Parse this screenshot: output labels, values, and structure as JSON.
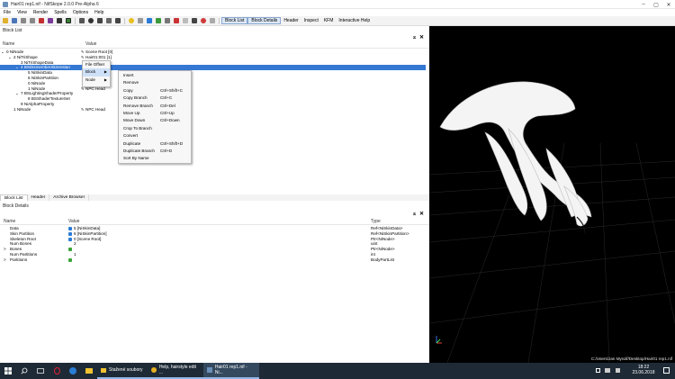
{
  "window": {
    "title": "Hair01 rep1.nif - NifSkope 2.0.0 Pre-Alpha 6"
  },
  "menubar": [
    "File",
    "View",
    "Render",
    "Spells",
    "Options",
    "Help"
  ],
  "toolbar": {
    "buttons": [
      "Block List",
      "Block Details",
      "Header",
      "Inspect",
      "KFM",
      "Interactive Help"
    ]
  },
  "block_list": {
    "title": "Block List",
    "col_name": "Name",
    "col_value": "Value",
    "rows": [
      {
        "name": "0 NiNode",
        "value": "Scene Root [0]",
        "indent": 0,
        "expand": "⌄"
      },
      {
        "name": "2 NiTriShape",
        "value": "Hair01:001 [1]",
        "indent": 1,
        "expand": "⌄"
      },
      {
        "name": "3 NiTriShapeData",
        "value": "",
        "indent": 2,
        "expand": ""
      },
      {
        "name": "4 BSDismemberSkinInstan",
        "value": "",
        "indent": 2,
        "expand": "⌄",
        "selected": true
      },
      {
        "name": "5 NiSkinData",
        "value": "",
        "indent": 3,
        "expand": ""
      },
      {
        "name": "6 NiSkinPartition",
        "value": "",
        "indent": 3,
        "expand": ""
      },
      {
        "name": "0 NiNode",
        "value": "",
        "indent": 3,
        "expand": ""
      },
      {
        "name": "1 NiNode",
        "value": "NPC Head",
        "indent": 3,
        "expand": ""
      },
      {
        "name": "7 BSLightingShaderProperty",
        "value": "",
        "indent": 2,
        "expand": "⌄"
      },
      {
        "name": "8 BSShaderTextureSet",
        "value": "",
        "indent": 3,
        "expand": ""
      },
      {
        "name": "9 NiAlphaProperty",
        "value": "",
        "indent": 2,
        "expand": ""
      },
      {
        "name": "1 NiNode",
        "value": "NPC Head",
        "indent": 1,
        "expand": ""
      }
    ]
  },
  "context_menu": {
    "items": [
      "File Offset",
      "Block",
      "Node"
    ]
  },
  "block_submenu": {
    "items": [
      {
        "label": "Insert",
        "shortcut": ""
      },
      {
        "label": "Remove",
        "shortcut": ""
      },
      {
        "label": "Copy",
        "shortcut": "Ctrl+Shift+C"
      },
      {
        "label": "Copy Branch",
        "shortcut": "Ctrl+C"
      },
      {
        "label": "Remove Branch",
        "shortcut": "Ctrl+Del"
      },
      {
        "label": "Move Up",
        "shortcut": "Ctrl+Up"
      },
      {
        "label": "Move Down",
        "shortcut": "Ctrl+Down"
      },
      {
        "label": "Crop To Branch",
        "shortcut": ""
      },
      {
        "label": "Convert",
        "shortcut": ""
      },
      {
        "label": "Duplicate",
        "shortcut": "Ctrl+Shift+D"
      },
      {
        "label": "Duplicate Branch",
        "shortcut": "Ctrl+D"
      },
      {
        "label": "Sort By Name",
        "shortcut": ""
      }
    ]
  },
  "bottom_tabs": [
    "Block List",
    "Header",
    "Archive Browser"
  ],
  "block_details": {
    "title": "Block Details",
    "col_name": "Name",
    "col_value": "Value",
    "col_type": "Type",
    "rows": [
      {
        "name": "Data",
        "value": "5 [NiSkinData]",
        "type": "Ref<NiSkinData>",
        "icon": "blue",
        "expand": ""
      },
      {
        "name": "Skin Partition",
        "value": "6 [NiSkinPartition]",
        "type": "Ref<NiSkinPartition>",
        "icon": "blue",
        "expand": ""
      },
      {
        "name": "Skeleton Root",
        "value": "0 [Scene Root]",
        "type": "Ptr<NiNode>",
        "icon": "blue",
        "expand": ""
      },
      {
        "name": "Num Bones",
        "value": "2",
        "type": "uint",
        "icon": "",
        "expand": ""
      },
      {
        "name": "Bones",
        "value": "",
        "type": "Ptr<NiNode>",
        "icon": "green",
        "expand": ">"
      },
      {
        "name": "Num Partitions",
        "value": "1",
        "type": "int",
        "icon": "",
        "expand": ""
      },
      {
        "name": "Partitions",
        "value": "",
        "type": "BodyPartList",
        "icon": "green",
        "expand": ">"
      }
    ]
  },
  "status": {
    "path": "C:/Users/Jan Mynář/Desktop/Hair01 rep1.nif"
  },
  "taskbar": {
    "apps": [
      "Stažené soubory",
      "Help, hairstyle edit ...",
      "Hair01 rep1.nif - Ni..."
    ],
    "time": "18:22",
    "date": "23.06.2018"
  },
  "colors": {
    "selection": "#3478d4",
    "viewport_bg": "#000000",
    "taskbar_bg": "#1e2a36"
  }
}
